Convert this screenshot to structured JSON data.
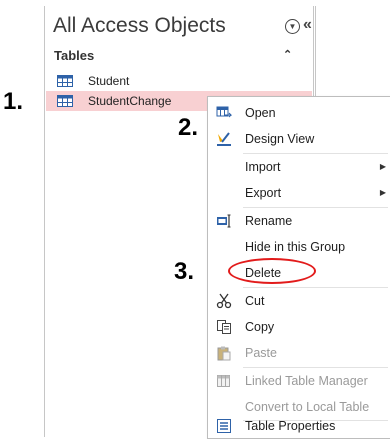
{
  "nav": {
    "title": "All Access Objects",
    "group": "Tables",
    "items": [
      {
        "label": "Student"
      },
      {
        "label": "StudentChange"
      }
    ]
  },
  "steps": {
    "one": "1.",
    "two": "2.",
    "three": "3."
  },
  "menu": {
    "open": "Open",
    "design_view": "Design View",
    "import": "Import",
    "export": "Export",
    "rename": "Rename",
    "hide": "Hide in this Group",
    "delete": "Delete",
    "cut": "Cut",
    "copy": "Copy",
    "paste": "Paste",
    "linked_table_manager": "Linked Table Manager",
    "convert": "Convert to Local Table",
    "table_properties": "Table Properties"
  },
  "colors": {
    "selected_row": "#f8d0d2",
    "highlight_ring": "#e21b1b"
  }
}
